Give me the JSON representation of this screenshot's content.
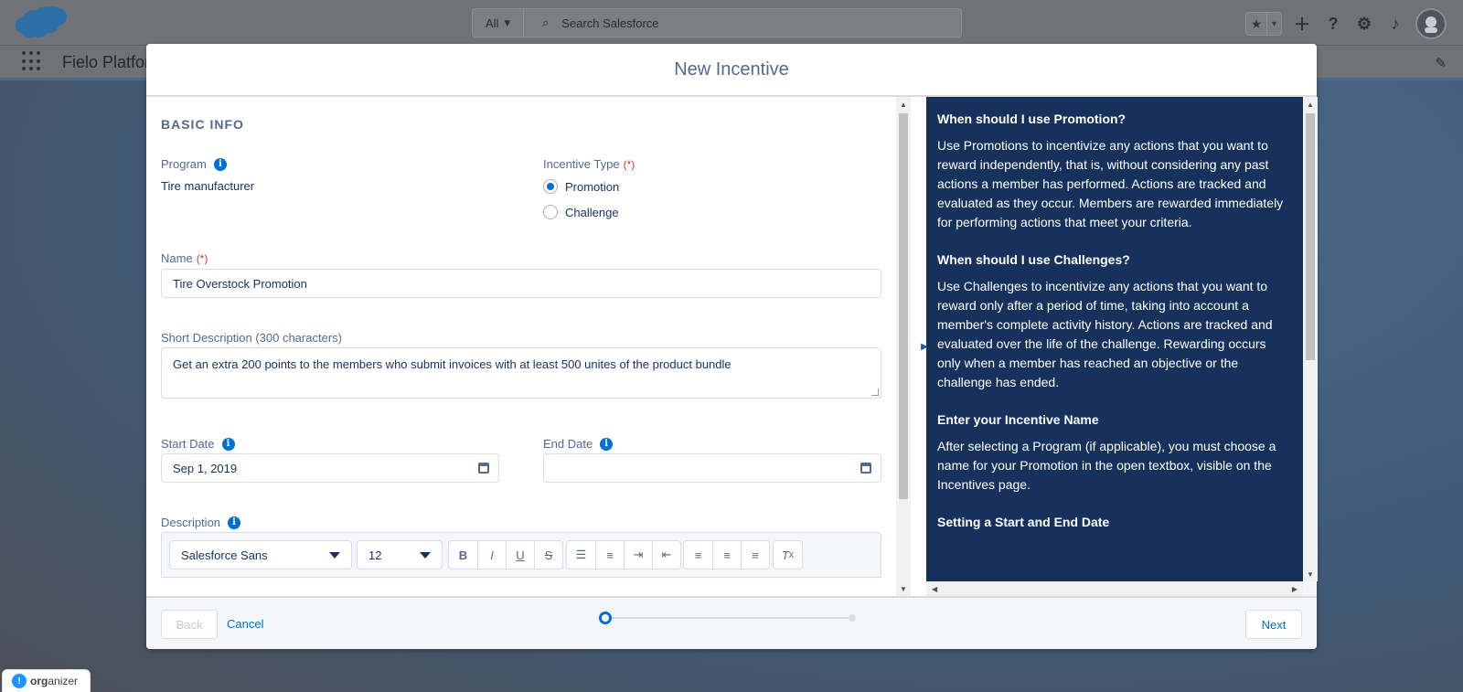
{
  "header": {
    "search_scope": "All",
    "search_placeholder": "Search Salesforce"
  },
  "nav": {
    "app_name": "Fielo Platform"
  },
  "modal": {
    "title": "New Incentive",
    "section_title": "BASIC INFO",
    "program": {
      "label": "Program",
      "value": "Tire manufacturer"
    },
    "incentive_type": {
      "label": "Incentive Type",
      "required_mark": "(*)",
      "options": [
        "Promotion",
        "Challenge"
      ],
      "selected": "Promotion"
    },
    "name": {
      "label": "Name",
      "required_mark": "(*)",
      "value": "Tire Overstock Promotion"
    },
    "short_description": {
      "label": "Short Description (300 characters)",
      "value": "Get an extra 200 points to the members who submit invoices with at least 500 unites of the product bundle"
    },
    "start_date": {
      "label": "Start Date",
      "value": "Sep 1, 2019"
    },
    "end_date": {
      "label": "End Date",
      "value": ""
    },
    "description": {
      "label": "Description",
      "font_family": "Salesforce Sans",
      "font_size": "12"
    },
    "help": [
      {
        "heading": "When should I use Promotion?",
        "text": "Use Promotions to incentivize any actions that you want to reward independently, that is, without considering any past actions a member has performed. Actions are tracked and evaluated as they occur. Members are rewarded immediately for performing actions that meet your criteria."
      },
      {
        "heading": "When should I use Challenges?",
        "text": "Use Challenges to incentivize any actions that you want to reward only after a period of time, taking into account a member's complete activity history. Actions are tracked and evaluated over the life of the challenge. Rewarding occurs only when a member has reached an objective or the challenge has ended."
      },
      {
        "heading": "Enter your Incentive Name",
        "text": "After selecting a Program (if applicable), you must choose a name for your Promotion in the open textbox, visible on the Incentives page."
      },
      {
        "heading": "Setting a Start and End Date",
        "text": ""
      }
    ],
    "footer": {
      "back_label": "Back",
      "cancel_label": "Cancel",
      "next_label": "Next",
      "progress_step": 1,
      "progress_total": 2
    }
  },
  "organizer": {
    "prefix": "org",
    "suffix": "anizer"
  },
  "colors": {
    "brand": "#0070d2",
    "help_panel": "#16325c"
  }
}
